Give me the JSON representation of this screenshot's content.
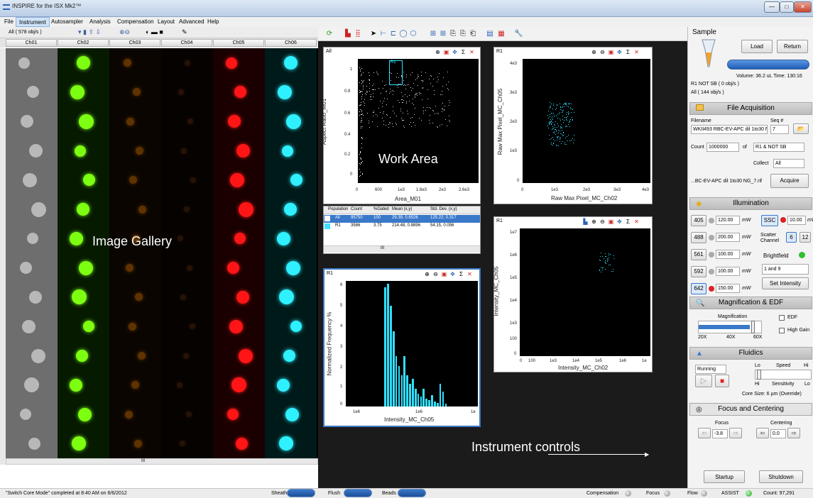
{
  "app": {
    "title": "INSPIRE for the ISX Mk2™",
    "win_min": "—",
    "win_max": "□",
    "win_close": "✕"
  },
  "menu": [
    "File",
    "Instrument",
    "Autosampler",
    "Analysis",
    "Compensation",
    "Layout",
    "Advanced",
    "Help"
  ],
  "gallery": {
    "population": "All  ( 578 obj/s )",
    "channels": [
      "Ch01",
      "Ch02",
      "Ch03",
      "Ch04",
      "Ch05",
      "Ch06"
    ],
    "overlay_label": "Image Gallery",
    "scroll_mark": "III"
  },
  "colors": {
    "ch02": "#7dff12",
    "ch03": "#a65a00",
    "ch04": "#5a2c10",
    "ch05": "#ff1515",
    "ch06": "#2ff0ff",
    "accent": "#3a78c9"
  },
  "work": {
    "overlay_label": "Work Area",
    "bottom_label": "Instrument controls"
  },
  "plots": {
    "scatter1": {
      "pop": "All",
      "ylabel": "Aspect Ratio_M01",
      "xlabel": "Area_M01",
      "xticks": [
        "0",
        "600",
        "1e3",
        "1.6e3",
        "2e3",
        "2.6e3"
      ],
      "yticks": [
        "1",
        "0.8",
        "0.6",
        "0.4",
        "0.2",
        "0"
      ],
      "gate": "R1"
    },
    "scatter2": {
      "pop": "R1",
      "ylabel": "Raw Max Pixel_MC_Ch05",
      "xlabel": "Raw Max Pixel_MC_Ch02",
      "xticks": [
        "0",
        "1e3",
        "2e3",
        "3e3",
        "4e3"
      ],
      "yticks": [
        "4e3",
        "3e3",
        "2e3",
        "1e3",
        "0"
      ]
    },
    "scatter3": {
      "pop": "R1",
      "ylabel": "Intensity_MC_Ch05",
      "xlabel": "Intensity_MC_Ch02",
      "xticks": [
        "0",
        "100",
        "1e3",
        "1e4",
        "1e5",
        "1e6",
        "1e"
      ],
      "yticks": [
        "1e7",
        "1e6",
        "1e5",
        "1e4",
        "1e3",
        "100",
        "0"
      ]
    },
    "hist": {
      "pop": "R1",
      "ylabel": "Normalized Frequency %",
      "xlabel": "Intensity_MC_Ch05",
      "xticks": [
        "1e6",
        "1e6",
        "1e"
      ],
      "yticks": [
        "6",
        "5",
        "4",
        "3",
        "2",
        "1",
        "0"
      ]
    }
  },
  "stats": {
    "headers": [
      "Population",
      "Count",
      "%Gated",
      "Mean (x,y)",
      "Std. Dev. (x,y)"
    ],
    "rows": [
      [
        "All",
        "95750",
        "100",
        "29.39,  0.6526",
        "125.22,  0.317"
      ],
      [
        "R1",
        "3586",
        "3.75",
        "214.48,  0.8896",
        "54.15,  0.056"
      ]
    ],
    "row_colors": [
      "#ffffff",
      "#3ee0ff"
    ],
    "scroll_mark": "III"
  },
  "sample": {
    "title": "Sample",
    "load": "Load",
    "return": "Return",
    "volume": "Volume: 36.2 uL   Time: 130:16",
    "pop1": "R1 NOT SB  ( 0 obj/s )",
    "pop2": "All  ( 144 obj/s )"
  },
  "file_acq": {
    "title": "File Acquisition",
    "filename_label": "Filename",
    "filename": "WKII493 RBC-EV-APC dil 1to30 N",
    "seq_label": "Seq #",
    "seq": "7",
    "count_label": "Count",
    "count": "1000000",
    "of": "of",
    "of_pop": "R1 & NOT SB",
    "collect_label": "Collect",
    "collect": "All",
    "file_out": "...BC-EV-APC dil 1to30 NG_7.rif",
    "acquire": "Acquire"
  },
  "illum": {
    "title": "Illumination",
    "lasers": [
      {
        "wl": "405",
        "pw": "120.00"
      },
      {
        "wl": "488",
        "pw": "200.00"
      },
      {
        "wl": "561",
        "pw": "100.00"
      },
      {
        "wl": "592",
        "pw": "100.00"
      },
      {
        "wl": "642",
        "pw": "150.00"
      }
    ],
    "unit": "mW",
    "ssc": "SSC",
    "ssc_pw": "10.00",
    "scatter_channel": "Scatter Channel",
    "ch6": "6",
    "ch12": "12",
    "brightfield": "Brightfield",
    "bf_ch": "1 and 9",
    "set_intensity": "Set Intensity"
  },
  "mag": {
    "title": "Magnification & EDF",
    "label": "Magnification",
    "ticks": [
      "20X",
      "40X",
      "60X"
    ],
    "edf": "EDF",
    "high_gain": "High Gain",
    "level": "60X"
  },
  "fluidics": {
    "title": "Fluidics",
    "state": "Running",
    "lo": "Lo",
    "speed": "Speed",
    "hi": "Hi",
    "hi2": "Hi",
    "sensitivity": "Sensitivity",
    "lo2": "Lo",
    "core": "Core Size: 6 µm (Override)"
  },
  "focus": {
    "title": "Focus and Centering",
    "focus_label": "Focus",
    "focus_val": "-3.8",
    "centering_label": "Centering",
    "centering_val": "0.0"
  },
  "power": {
    "startup": "Startup",
    "shutdown": "Shutdown"
  },
  "status": {
    "msg": "\"Switch Core Mode\" completed at 8:40 AM on 6/6/2012",
    "sheath": "Sheath",
    "flush": "Flush",
    "beads": "Beads",
    "comp": "Compensation",
    "focus": "Focus",
    "flow": "Flow",
    "assist": "ASSIST",
    "count": "Count: 97,291"
  }
}
